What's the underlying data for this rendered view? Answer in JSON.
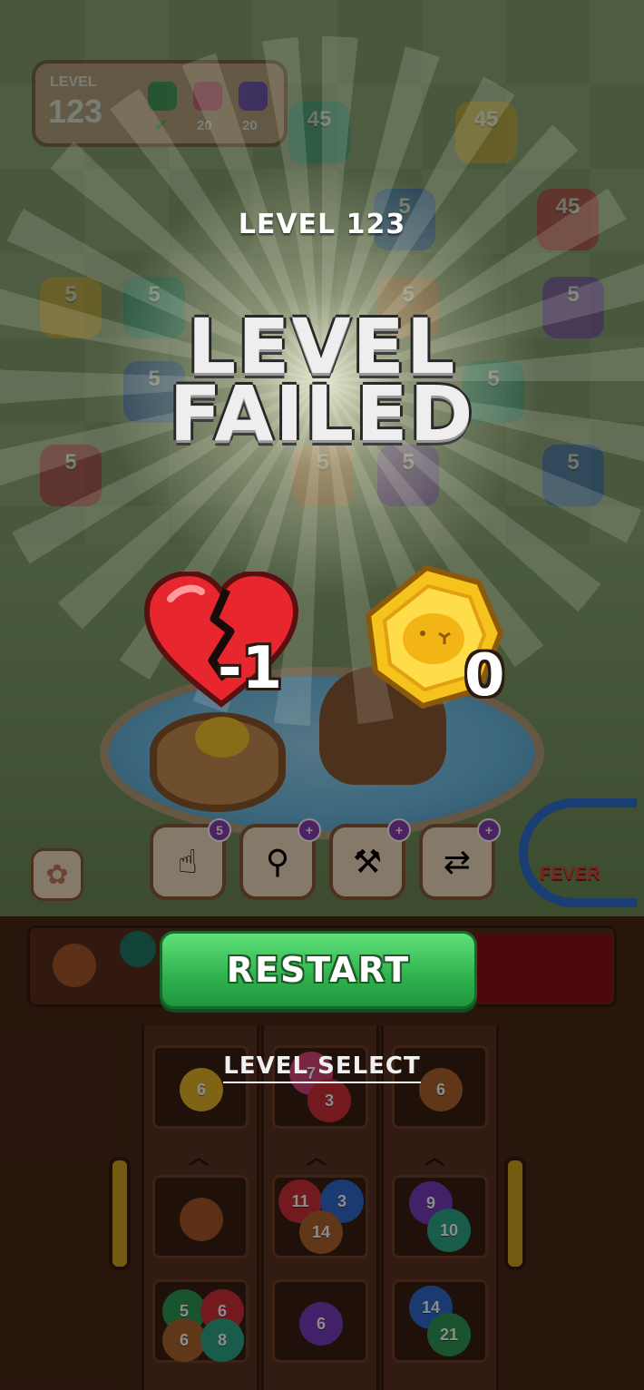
{
  "hud": {
    "level_title": "LEVEL",
    "level_number": "123",
    "goals": [
      {
        "color": "#2f9a57",
        "count": "✔"
      },
      {
        "color": "#d94b7a",
        "count": "20"
      },
      {
        "color": "#6a3bc2",
        "count": "20"
      }
    ]
  },
  "board": {
    "monsters": [
      {
        "value": "45",
        "color": "#2fa88a"
      },
      {
        "value": "45",
        "color": "#e7b628"
      },
      {
        "value": "5",
        "color": "#2e6ccf"
      },
      {
        "value": "45",
        "color": "#d2303a"
      },
      {
        "value": "5",
        "color": "#e7b628"
      },
      {
        "value": "5",
        "color": "#2fa88a"
      },
      {
        "value": "5",
        "color": "#e38a47"
      },
      {
        "value": "5",
        "color": "#7a3cc0"
      },
      {
        "value": "5",
        "color": "#2e6ccf"
      },
      {
        "value": "5",
        "color": "#2fa88a"
      },
      {
        "value": "5",
        "color": "#c02a3a"
      },
      {
        "value": "5",
        "color": "#e38a47"
      },
      {
        "value": "5",
        "color": "#7a3cc0"
      },
      {
        "value": "5",
        "color": "#2e6ccf"
      }
    ]
  },
  "boosters": [
    {
      "icon": "hand-icon",
      "badge": "5"
    },
    {
      "icon": "slingshot-icon",
      "badge": "+"
    },
    {
      "icon": "hammer-icon",
      "badge": "+"
    },
    {
      "icon": "swap-icon",
      "badge": "+"
    }
  ],
  "fever": {
    "label": "FEVER"
  },
  "tubes": {
    "top_row": [
      {
        "balls": [
          {
            "n": "6",
            "color": "#e7b628"
          }
        ]
      },
      {
        "balls": [
          {
            "n": "7",
            "color": "#d9457a"
          },
          {
            "n": "3",
            "color": "#d2303a"
          }
        ]
      },
      {
        "balls": [
          {
            "n": "6",
            "color": "#b0642c"
          }
        ]
      }
    ],
    "mid_row": [
      {
        "balls": [
          {
            "n": "",
            "color": "#a8582a"
          }
        ]
      },
      {
        "balls": [
          {
            "n": "11",
            "color": "#d2303a"
          },
          {
            "n": "3",
            "color": "#2e6ccf"
          },
          {
            "n": "14",
            "color": "#b0642c"
          }
        ]
      },
      {
        "balls": [
          {
            "n": "9",
            "color": "#7a3cc0"
          },
          {
            "n": "10",
            "color": "#2fa88a"
          }
        ]
      }
    ],
    "bottom_row": [
      {
        "balls": [
          {
            "n": "5",
            "color": "#2f9a57"
          },
          {
            "n": "6",
            "color": "#d2303a"
          },
          {
            "n": "6",
            "color": "#b0642c"
          },
          {
            "n": "8",
            "color": "#2fa88a"
          }
        ]
      },
      {
        "balls": [
          {
            "n": "6",
            "color": "#7a3cc0"
          }
        ]
      },
      {
        "balls": [
          {
            "n": "14",
            "color": "#2e6ccf"
          },
          {
            "n": "21",
            "color": "#2f9a57"
          }
        ]
      }
    ]
  },
  "overlay": {
    "level_label": "LEVEL 123",
    "title_line1": "LEVEL",
    "title_line2": "FAILED",
    "hearts_delta": "-1",
    "coins": "0",
    "restart_label": "RESTART",
    "level_select_label": "LEVEL SELECT"
  },
  "colors": {
    "restart_green": "#2fb14d",
    "heart_red": "#e8262e",
    "coin_gold": "#f6c21c"
  }
}
